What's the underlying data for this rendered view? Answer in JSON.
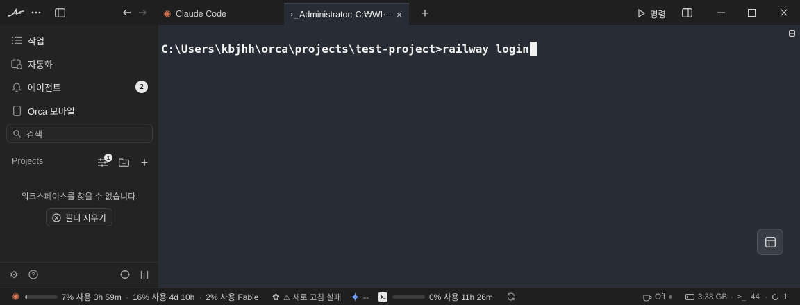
{
  "titlebar": {
    "tabs": [
      {
        "label": "Claude Code"
      },
      {
        "label": "Administrator: C:₩WI···"
      }
    ],
    "run_label": "명령"
  },
  "sidebar": {
    "items": [
      {
        "label": "작업",
        "icon": "list-icon"
      },
      {
        "label": "자동화",
        "icon": "calendar-clock-icon"
      },
      {
        "label": "에이전트",
        "icon": "bell-icon",
        "badge": "2"
      },
      {
        "label": "Orca 모바일",
        "icon": "phone-icon"
      }
    ],
    "search_placeholder": "검색",
    "projects_label": "Projects",
    "filter_badge": "1",
    "empty_message": "워크스페이스를 찾을 수 없습니다.",
    "clear_filter_label": "필터 지우기"
  },
  "terminal": {
    "line": "C:\\Users\\kbjhh\\orca\\projects\\test-project>railway login"
  },
  "statusbar": {
    "claude_usage": {
      "progress": 0.07,
      "five_hour": "7% 사용 3h 59m",
      "weekly": "16% 사용 4d 10h",
      "fable": "2% 사용 Fable"
    },
    "refresh_failed": "⚠ 새로 고침 실패",
    "gemini_value": "--",
    "codex_usage": {
      "progress": 0.0,
      "text": "0% 사용 11h 26m"
    },
    "off_label": "Off",
    "memory": "3.38 GB",
    "terminals_count": "44",
    "sessions_count": "1"
  },
  "colors": {
    "accent_claude": "#d97757",
    "terminal_bg": "#282c34",
    "sidebar_bg": "#232323"
  }
}
